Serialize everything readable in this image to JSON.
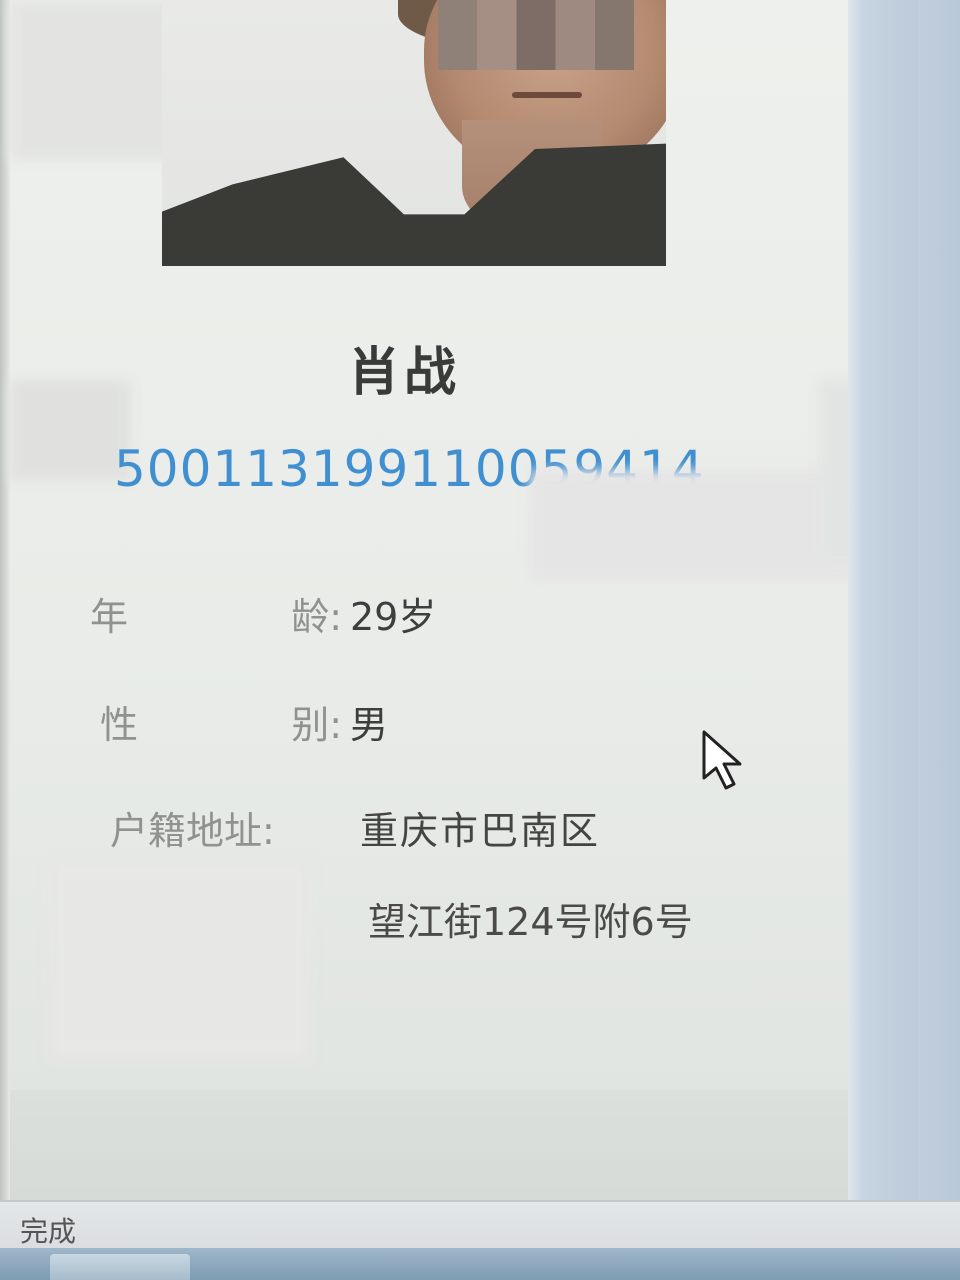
{
  "profile": {
    "name": "肖战",
    "id_number": "500113199110059414",
    "fields": {
      "age_label": [
        "年",
        "龄:"
      ],
      "age_value": "29岁",
      "gender_label": [
        "性",
        "别:"
      ],
      "gender_value": "男",
      "address_label": "户籍地址:",
      "address_value": "重庆市巴南区",
      "home_value": "望江街124号附6号"
    }
  },
  "status_bar": {
    "text": "完成"
  },
  "colors": {
    "id_number": "#3f8fd1",
    "name": "#3a3a3a",
    "label": "#8f9390"
  }
}
